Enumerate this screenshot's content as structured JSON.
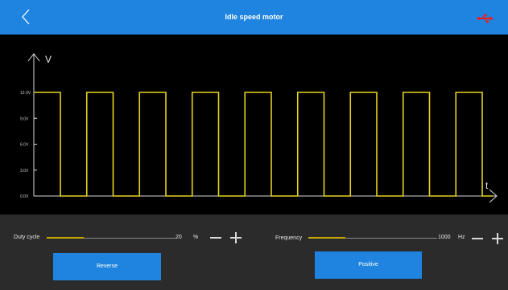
{
  "header": {
    "title": "Idle speed motor",
    "back_icon": "chevron-left-icon",
    "usb_icon": "usb-icon",
    "usb_color": "#e5202a",
    "bar_color": "#1f84df"
  },
  "chart_data": {
    "type": "line",
    "title": "",
    "xlabel": "t",
    "ylabel": "V",
    "ylim": [
      0,
      12
    ],
    "y_ticks": [
      "12.0V",
      "9.0V",
      "6.0V",
      "3.0V",
      "0.0V"
    ],
    "y_tick_values": [
      12,
      9,
      6,
      3,
      0
    ],
    "grid": false,
    "series": [
      {
        "line_color": "#e6d21e",
        "high": 12.0,
        "low": 0.0,
        "period": 1.0,
        "high_fraction": 0.5,
        "cycles": 8
      }
    ]
  },
  "stray_text": "r",
  "controls": {
    "duty": {
      "label": "Duty cycle",
      "value": "20",
      "unit": "%",
      "level": 0.0
    },
    "frequency": {
      "label": "Frequency",
      "value": "1000",
      "unit": "Hz",
      "level": 0.0
    },
    "reverse_label": "Reverse",
    "positive_label": "Positive"
  }
}
